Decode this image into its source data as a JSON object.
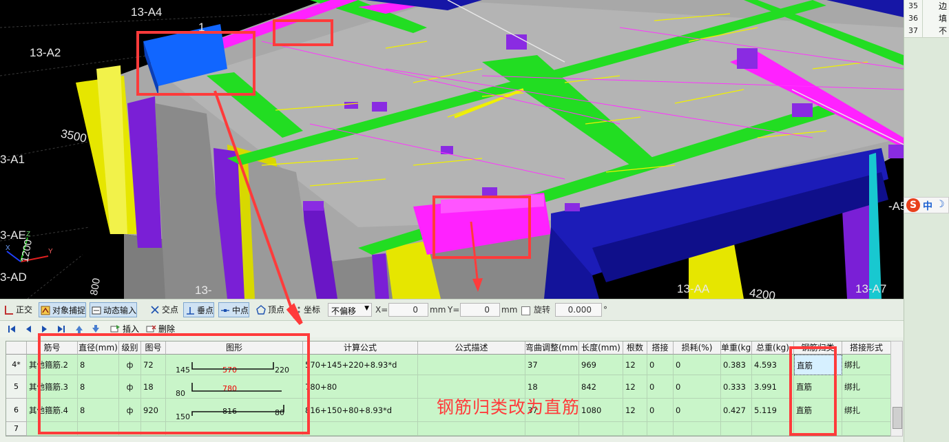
{
  "viewport": {
    "axis_labels": [
      "13-A4",
      "13-A2",
      "3500",
      "3-A1",
      "3-AE",
      "3-AD",
      "1200",
      "800",
      "13-",
      "13-AA",
      "4200",
      "13-A7",
      "-A5",
      "1"
    ],
    "cube_labels": {
      "x": "X",
      "y": "Y",
      "z": "Z"
    }
  },
  "right_panel": {
    "rows": [
      {
        "num": "35",
        "text": "边"
      },
      {
        "num": "36",
        "text": "填"
      },
      {
        "num": "37",
        "text": "不"
      }
    ]
  },
  "ime": {
    "logo": "S",
    "mode": "中",
    "moon": "☽"
  },
  "toolbar": {
    "ortho": "正交",
    "snap": "对象捕捉",
    "dyninput": "动态输入",
    "intersection": "交点",
    "perpendicular": "垂点",
    "midpoint": "中点",
    "vertex": "顶点",
    "coord": "坐标",
    "offset_mode": "不偏移",
    "x_label": "X=",
    "x_value": "0",
    "y_label": "Y=",
    "y_value": "0",
    "unit": "mm",
    "unit2": "mm",
    "rotate_label": "旋转",
    "rotate_value": "0.000",
    "degree": "°"
  },
  "navbar": {
    "insert": "插入",
    "delete": "删除"
  },
  "table": {
    "headers": [
      "筋号",
      "直径(mm)",
      "级别",
      "图号",
      "图形",
      "计算公式",
      "公式描述",
      "弯曲调整(mm)",
      "长度(mm)",
      "根数",
      "搭接",
      "损耗(%)",
      "单重(kg)",
      "总重(kg)",
      "钢筋归类",
      "搭接形式"
    ],
    "rows": [
      {
        "row": "4*",
        "name": "其他箍筋.2",
        "dia": "8",
        "grade": "ф",
        "fig": "72",
        "shape": {
          "left": "145",
          "mid": "570",
          "right": "220"
        },
        "formula": "570+145+220+8.93*d",
        "desc": "",
        "bend": "37",
        "length": "969",
        "count": "12",
        "lap": "0",
        "loss": "0",
        "unit_w": "0.383",
        "total_w": "4.593",
        "category": "直筋",
        "lap_type": "绑扎"
      },
      {
        "row": "5",
        "name": "其他箍筋.3",
        "dia": "8",
        "grade": "ф",
        "fig": "18",
        "shape": {
          "left": "80",
          "mid": "780",
          "right": ""
        },
        "formula": "780+80",
        "desc": "",
        "bend": "18",
        "length": "842",
        "count": "12",
        "lap": "0",
        "loss": "0",
        "unit_w": "0.333",
        "total_w": "3.991",
        "category": "直筋",
        "lap_type": "绑扎"
      },
      {
        "row": "6",
        "name": "其他箍筋.4",
        "dia": "8",
        "grade": "ф",
        "fig": "920",
        "shape": {
          "left": "150",
          "mid": "816",
          "right": "80"
        },
        "formula": "816+150+80+8.93*d",
        "desc": "",
        "bend": "37",
        "length": "1080",
        "count": "12",
        "lap": "0",
        "loss": "0",
        "unit_w": "0.427",
        "total_w": "5.119",
        "category": "直筋",
        "lap_type": "绑扎"
      },
      {
        "row": "7",
        "name": "",
        "dia": "",
        "grade": "",
        "fig": "",
        "shape": {
          "left": "",
          "mid": "",
          "right": ""
        },
        "formula": "",
        "desc": "",
        "bend": "",
        "length": "",
        "count": "",
        "lap": "",
        "loss": "",
        "unit_w": "",
        "total_w": "",
        "category": "",
        "lap_type": ""
      }
    ]
  },
  "annotation": "钢筋归类改为直筋",
  "colors": {
    "highlight": "#ff3b3b",
    "slab": "#a8a8a8",
    "beam_green": "#22dd22",
    "beam_magenta": "#ff22ff",
    "column_yellow": "#e6e600",
    "column_purple": "#7a1fd6",
    "beam_blue": "#1616a6",
    "grid_bg": "#c9f5c9"
  }
}
